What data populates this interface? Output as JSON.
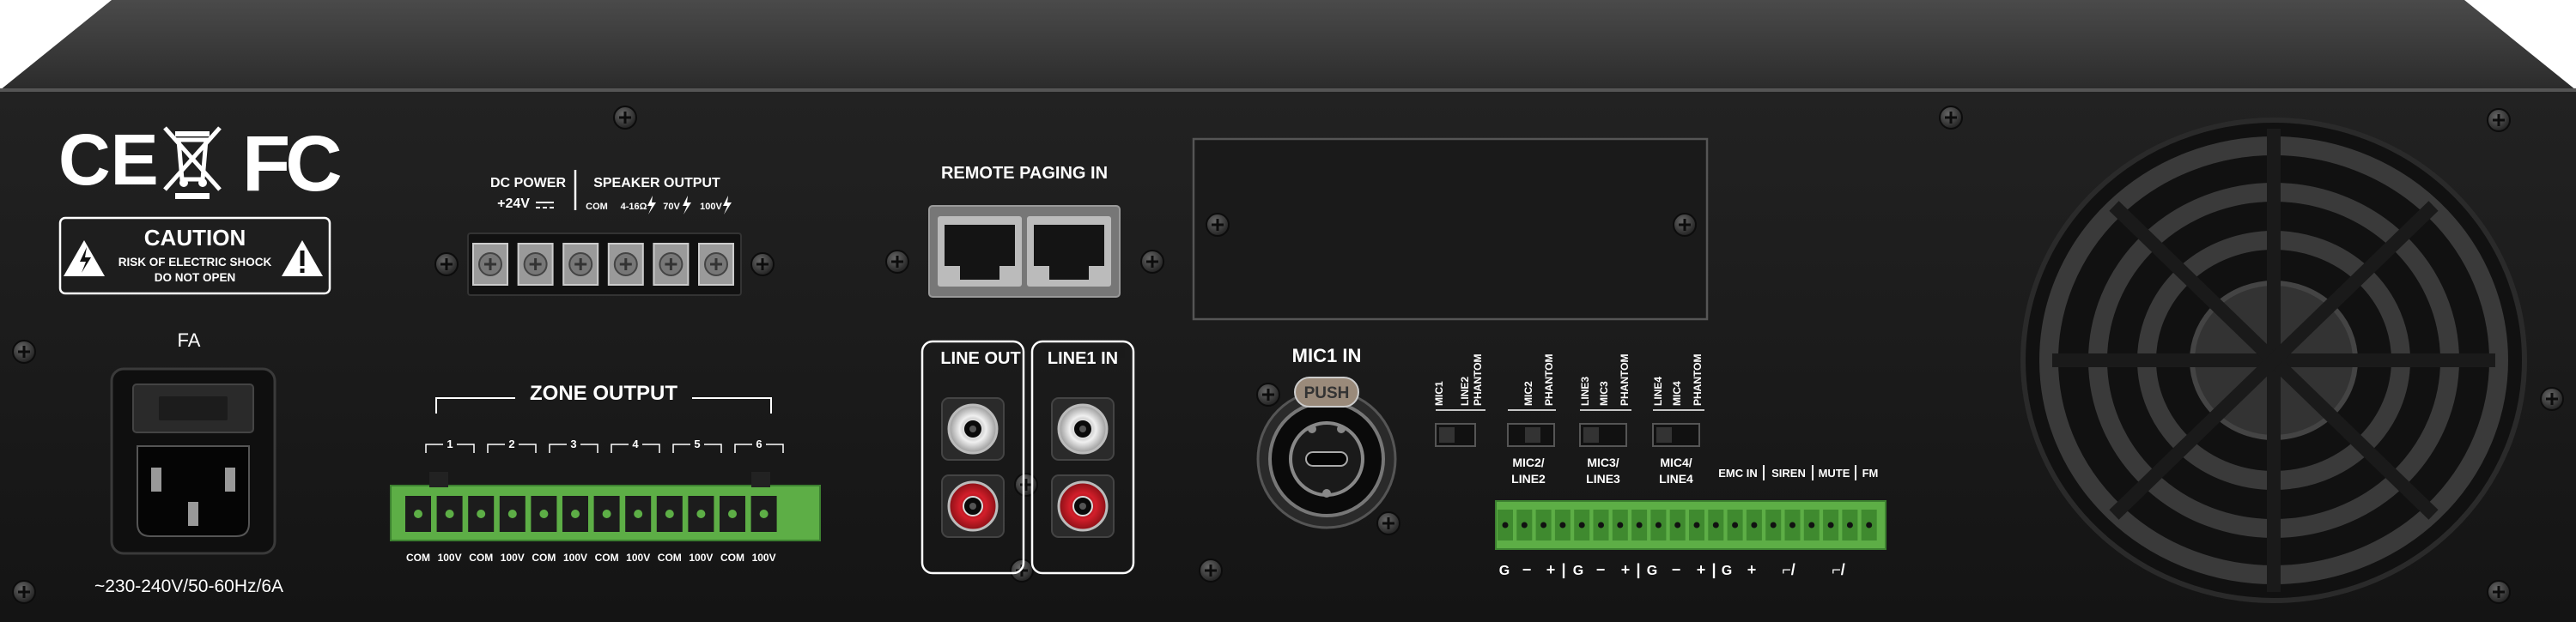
{
  "certifications": {
    "ce": "CE",
    "fc": "FC"
  },
  "caution": {
    "title": "CAUTION",
    "line1": "RISK OF ELECTRIC SHOCK",
    "line2": "DO NOT OPEN"
  },
  "power": {
    "fuse_label": "FA",
    "rating": "~230-240V/50-60Hz/6A"
  },
  "dc_power": {
    "label": "DC POWER",
    "voltage": "+24V"
  },
  "speaker_output": {
    "label": "SPEAKER OUTPUT",
    "com": "COM",
    "ohm": "4-16Ω",
    "v70": "70V",
    "v100": "100V"
  },
  "remote_paging": {
    "label": "REMOTE PAGING IN"
  },
  "line_out": {
    "label": "LINE OUT"
  },
  "line1_in": {
    "label": "LINE1 IN"
  },
  "mic1_in": {
    "label": "MIC1 IN",
    "push": "PUSH"
  },
  "zone_output": {
    "label": "ZONE OUTPUT",
    "zones": [
      "1",
      "2",
      "3",
      "4",
      "5",
      "6"
    ],
    "terminals": [
      "COM",
      "100V",
      "COM",
      "100V",
      "COM",
      "100V",
      "COM",
      "100V",
      "COM",
      "100V",
      "COM",
      "100V"
    ]
  },
  "dip_switches": {
    "sw1": {
      "a": "MIC1",
      "b": "PHANTOM"
    },
    "sw2": {
      "a": "LINE2",
      "b": "MIC2",
      "c": "PHANTOM"
    },
    "sw3": {
      "a": "LINE3",
      "b": "MIC3",
      "c": "PHANTOM"
    },
    "sw4": {
      "a": "LINE4",
      "b": "MIC4",
      "c": "PHANTOM"
    }
  },
  "input_groups": {
    "g2": {
      "l1": "MIC2/",
      "l2": "LINE2"
    },
    "g3": {
      "l1": "MIC3/",
      "l2": "LINE3"
    },
    "g4": {
      "l1": "MIC4/",
      "l2": "LINE4"
    }
  },
  "control_inputs": {
    "emc": "EMC IN",
    "siren": "SIREN",
    "mute": "MUTE",
    "fm": "FM"
  },
  "bottom_terminals": {
    "g": "G",
    "minus": "−",
    "plus": "+",
    "sep": "|",
    "switch": "⌐/"
  },
  "colors": {
    "chassis": "#1a1a1a",
    "chassis_top": "#3b3b3b",
    "terminal_green": "#5dae46",
    "rca_red": "#d21e2a",
    "rca_white": "#e8e8e8"
  }
}
